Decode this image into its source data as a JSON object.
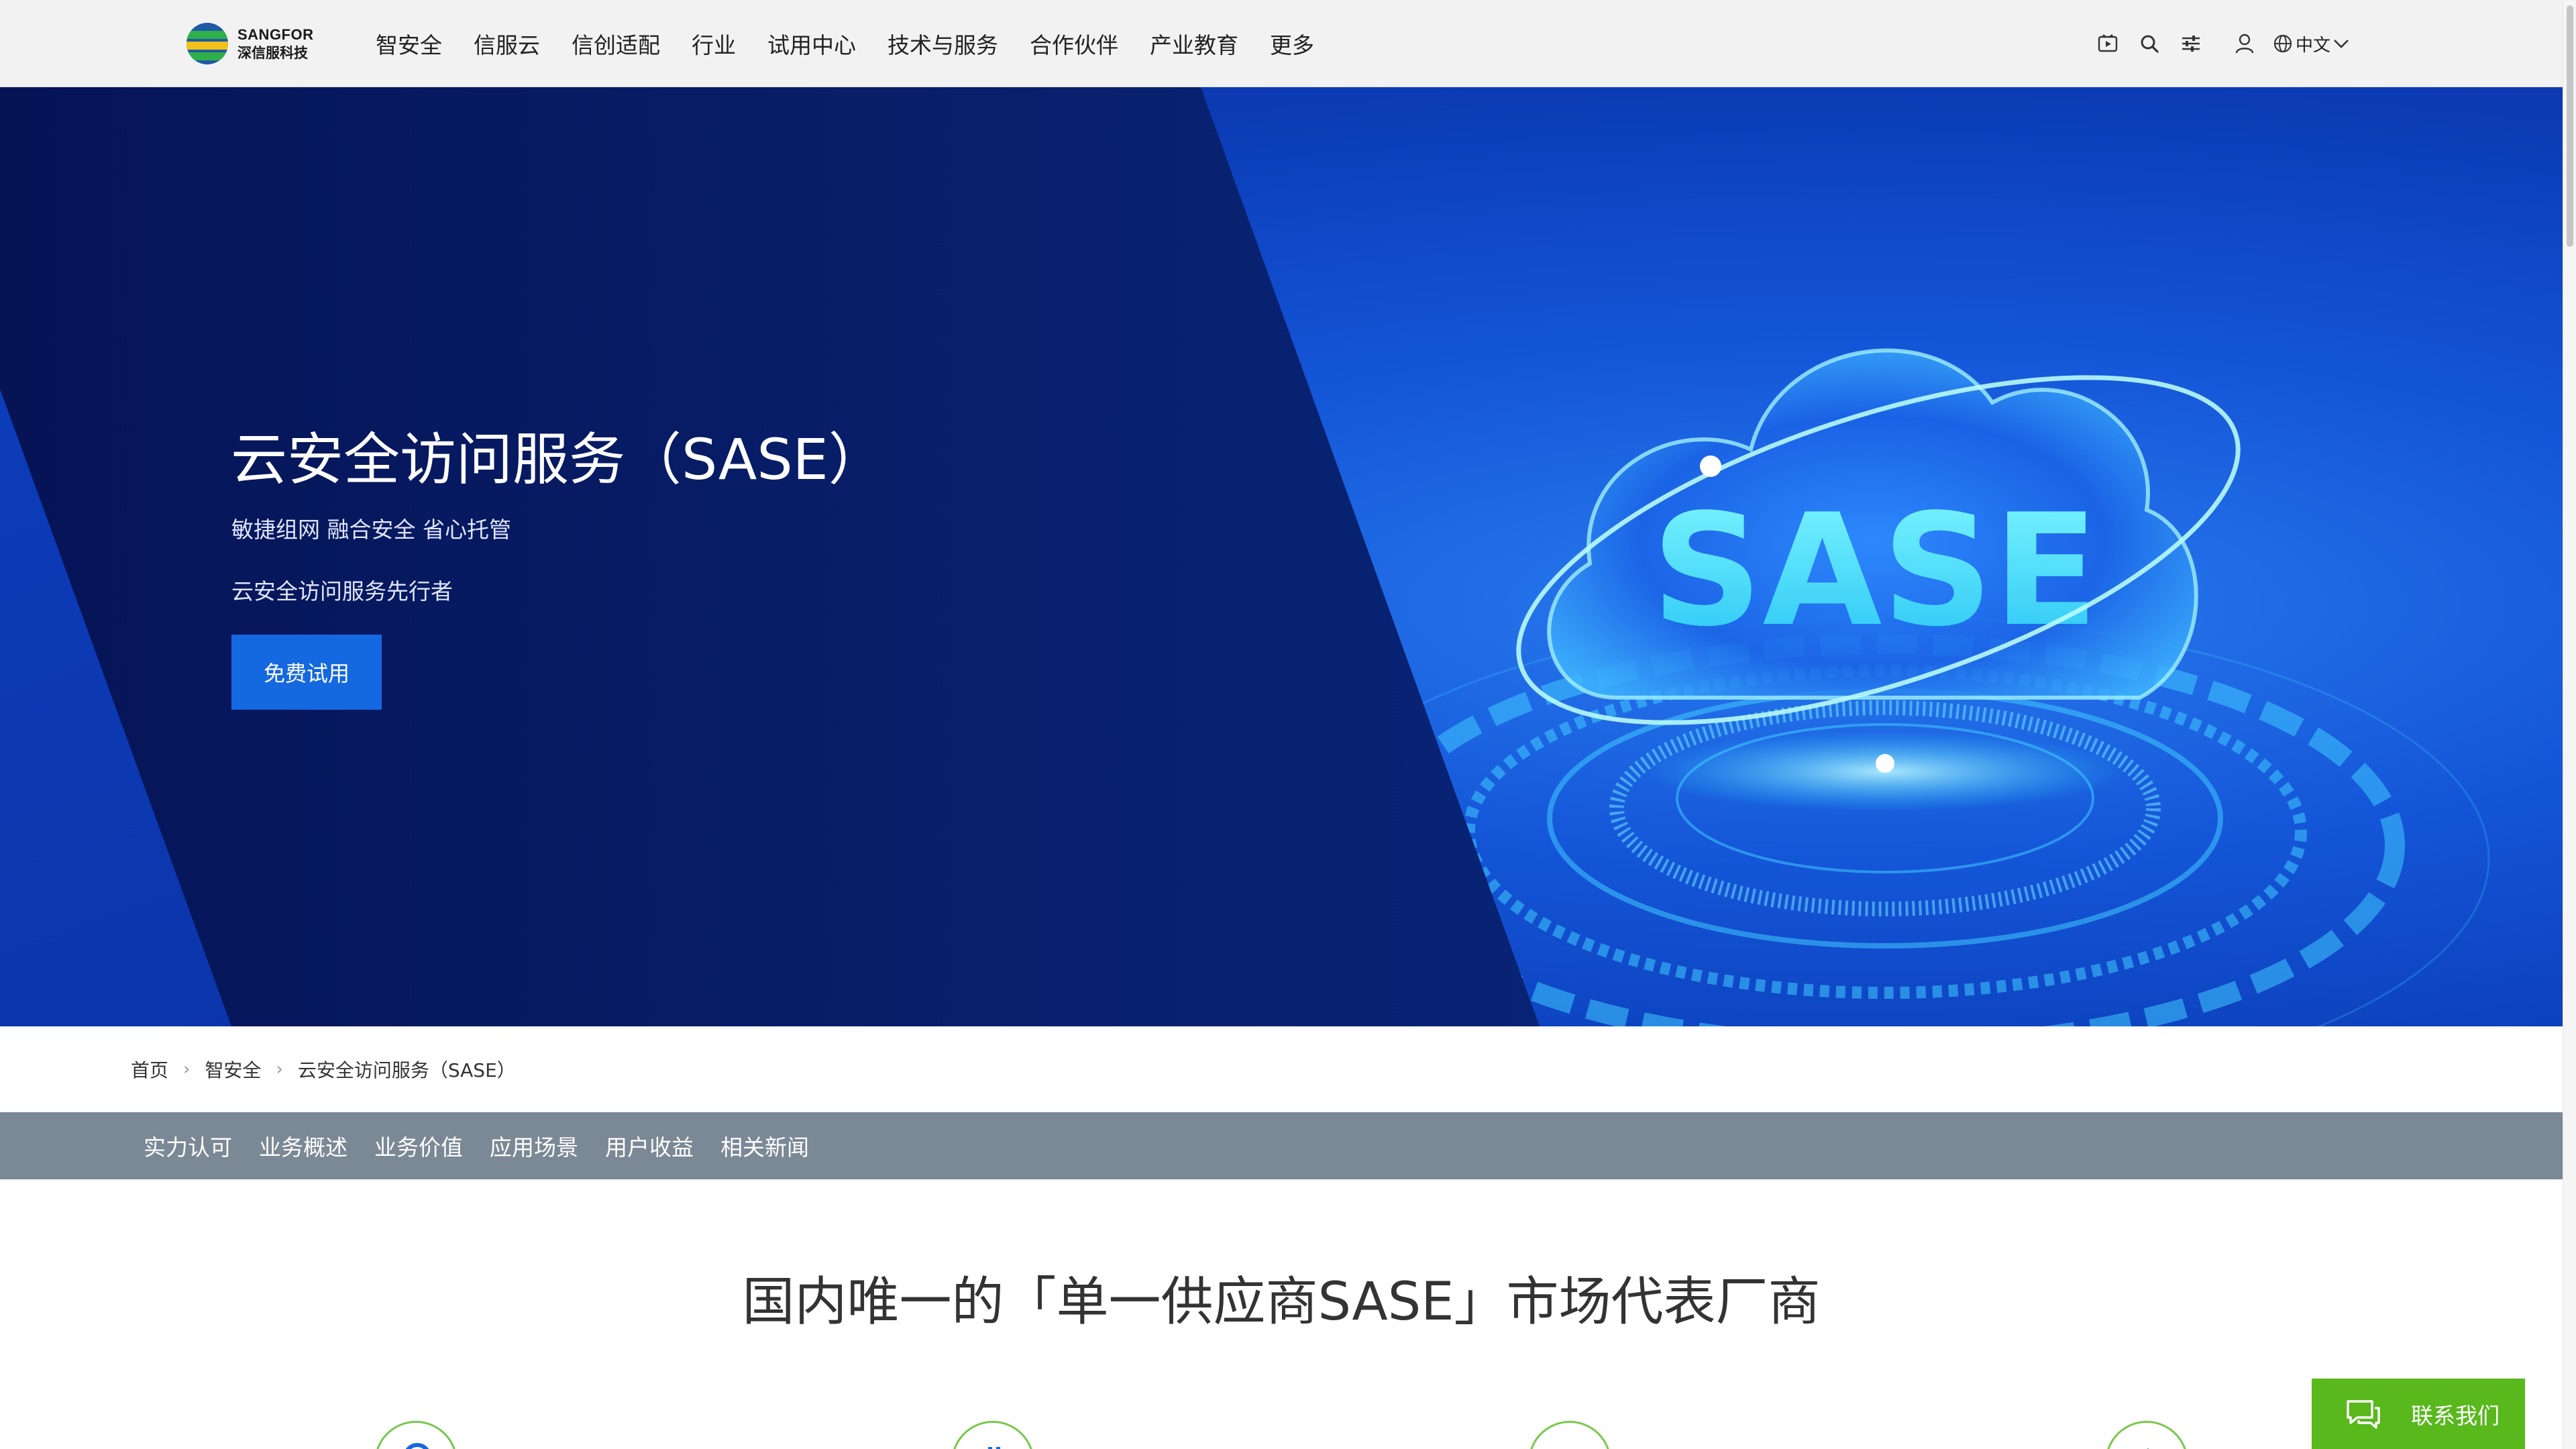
{
  "brand": {
    "name_en": "SANGFOR",
    "name_cn": "深信服科技"
  },
  "nav": {
    "items": [
      "智安全",
      "信服云",
      "信创适配",
      "行业",
      "试用中心",
      "技术与服务",
      "合作伙伴",
      "产业教育",
      "更多"
    ]
  },
  "toolbar": {
    "language": "中文"
  },
  "hero": {
    "title": "云安全访问服务（SASE）",
    "subtitle1": "敏捷组网 融合安全 省心托管",
    "subtitle2": "云安全访问服务先行者",
    "cta": "免费试用",
    "art_text": "SASE"
  },
  "breadcrumb": [
    "首页",
    "智安全",
    "云安全访问服务（SASE）"
  ],
  "section_nav": [
    "实力认可",
    "业务概述",
    "业务价值",
    "应用场景",
    "用户收益",
    "相关新闻"
  ],
  "main": {
    "heading": "国内唯一的「单一供应商SASE」市场代表厂商"
  },
  "contact": {
    "label": "联系我们"
  },
  "colors": {
    "accent": "#1468e0",
    "contact_green": "#58b81c",
    "section_nav_bg": "#7b8896",
    "header_bg": "#f2f2f2"
  }
}
